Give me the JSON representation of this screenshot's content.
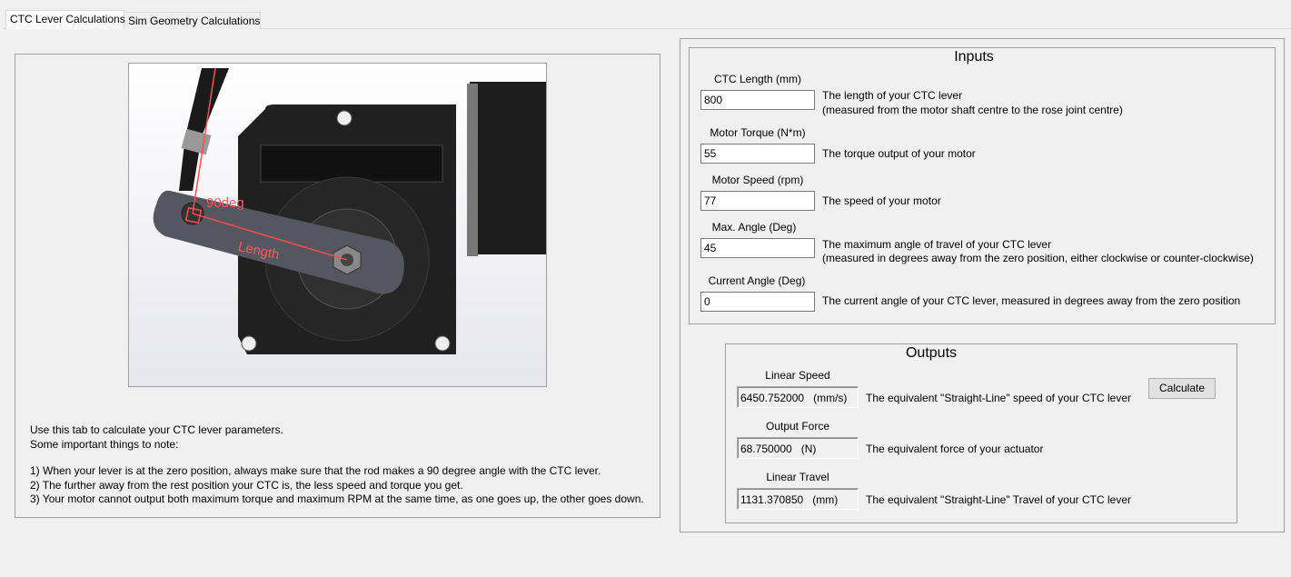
{
  "tabs": [
    {
      "label": "CTC Lever Calculations",
      "active": true
    },
    {
      "label": "Sim Geometry Calculations",
      "active": false
    }
  ],
  "image": {
    "angle_label": "90deg",
    "length_label": "Length"
  },
  "notes": {
    "intro1": "Use this tab to calculate your CTC lever parameters.",
    "intro2": "Some important things to note:",
    "n1": "1) When your lever is at the zero position, always make sure that the rod makes a 90 degree angle with the CTC lever.",
    "n2": "2) The further away from the rest position your CTC is, the less speed and torque you get.",
    "n3": "3) Your motor cannot output both maximum torque and maximum RPM at the same time, as one goes up, the other goes down."
  },
  "inputs": {
    "title": "Inputs",
    "ctc_length": {
      "label": "CTC Length (mm)",
      "value": "800",
      "desc1": "The length of your CTC lever",
      "desc2": "(measured from the motor shaft centre to the rose joint centre)"
    },
    "motor_torque": {
      "label": "Motor Torque (N*m)",
      "value": "55",
      "desc1": "The torque output of your motor"
    },
    "motor_speed": {
      "label": "Motor Speed (rpm)",
      "value": "77",
      "desc1": "The speed of your motor"
    },
    "max_angle": {
      "label": "Max. Angle (Deg)",
      "value": "45",
      "desc1": "The maximum angle of travel of your CTC lever",
      "desc2": "(measured in degrees away from the zero position, either clockwise or counter-clockwise)"
    },
    "current_angle": {
      "label": "Current Angle (Deg)",
      "value": "0",
      "desc1": "The current angle of your CTC lever, measured in degrees away from the zero position"
    }
  },
  "outputs": {
    "title": "Outputs",
    "calculate": "Calculate",
    "linear_speed": {
      "label": "Linear Speed",
      "value": "6450.752000",
      "unit": "(mm/s)",
      "desc": "The equivalent \"Straight-Line\" speed of your CTC lever"
    },
    "output_force": {
      "label": "Output Force",
      "value": "68.750000",
      "unit": "(N)",
      "desc": "The equivalent force of your actuator"
    },
    "linear_travel": {
      "label": "Linear Travel",
      "value": "1131.370850",
      "unit": "(mm)",
      "desc": "The equivalent \"Straight-Line\" Travel of your CTC lever"
    }
  }
}
